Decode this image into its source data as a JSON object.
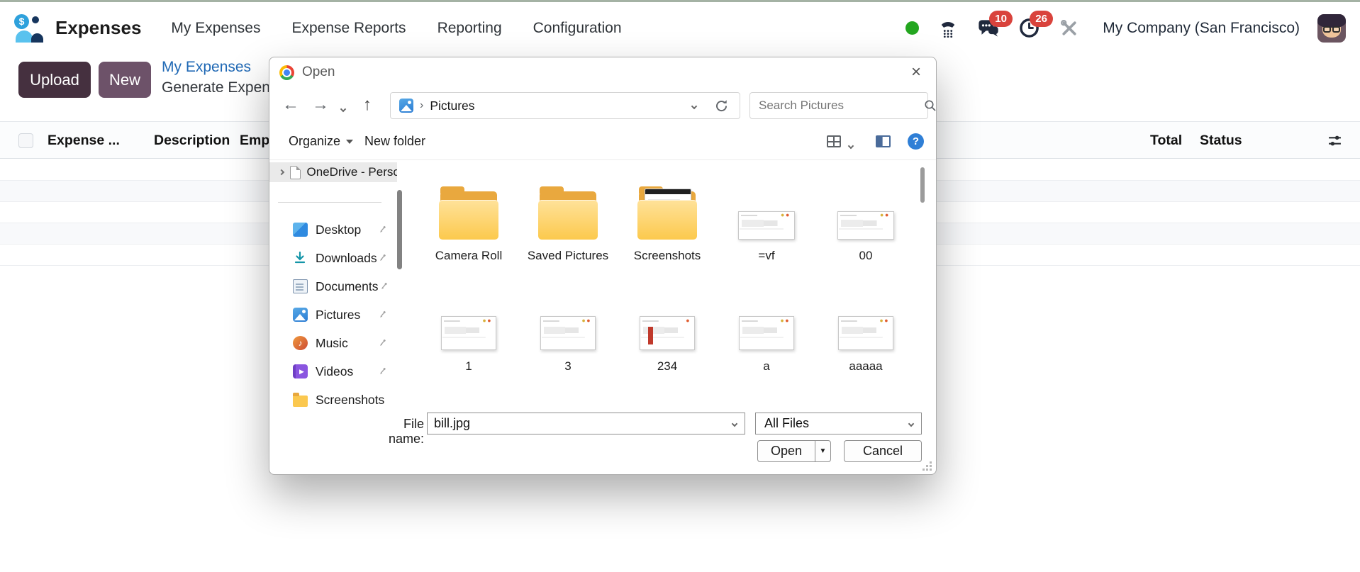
{
  "colors": {
    "top_accent": "#a4b2a4",
    "upload_button_bg": "#45303f",
    "new_button_bg": "#6d5269",
    "breadcrumb_link_blue": "#2069b5",
    "badge_red": "#d9433c",
    "status_green": "#23a61f",
    "folder_yellow": "#fcc94d",
    "help_blue": "#2f7fd6"
  },
  "icons": {
    "app": "expenses-app-icon",
    "status": "green-dot",
    "voip": "phone-icon",
    "messages": "chat-bubbles-icon",
    "activities": "clock-icon",
    "tools": "wrench-icon",
    "columns": "sliders-icon",
    "back": "left-arrow",
    "forward": "right-arrow",
    "parent": "up-arrow",
    "refresh": "circular-arrow",
    "search": "magnifier",
    "help": "question-circle",
    "browser": "chrome-logo",
    "pin": "pushpin",
    "dropdown": "chevron-down"
  },
  "navbar": {
    "app_name": "Expenses",
    "menus": [
      "My Expenses",
      "Expense Reports",
      "Reporting",
      "Configuration"
    ],
    "messages_badge": "10",
    "activities_badge": "26",
    "company": "My Company (San Francisco)"
  },
  "actionbar": {
    "upload_label": "Upload",
    "new_label": "New",
    "breadcrumb": "My Expenses",
    "subtitle": "Generate Expen"
  },
  "list": {
    "headers": [
      "Expense ...",
      "Description",
      "Emp"
    ],
    "total_header": "Total",
    "status_header": "Status"
  },
  "dialog": {
    "title": "Open",
    "nav": {
      "location": "Pictures",
      "search_placeholder": "Search Pictures"
    },
    "toolbar": {
      "organize_label": "Organize",
      "new_folder_label": "New folder"
    },
    "sidebar": {
      "onedrive_label": "OneDrive - Perso",
      "items": [
        "Desktop",
        "Downloads",
        "Documents",
        "Pictures",
        "Music",
        "Videos",
        "Screenshots"
      ]
    },
    "grid": {
      "row1": [
        {
          "label": "Camera Roll",
          "kind": "folder"
        },
        {
          "label": "Saved Pictures",
          "kind": "folder"
        },
        {
          "label": "Screenshots",
          "kind": "folder-with-screenshot"
        },
        {
          "label": "=vf",
          "kind": "image-file"
        },
        {
          "label": "00",
          "kind": "image-file"
        }
      ],
      "row2": [
        {
          "label": "1",
          "kind": "image-file"
        },
        {
          "label": "3",
          "kind": "image-file"
        },
        {
          "label": "234",
          "kind": "image-file"
        },
        {
          "label": "a",
          "kind": "image-file"
        },
        {
          "label": "aaaaa",
          "kind": "image-file"
        }
      ]
    },
    "footer": {
      "filename_label": "File name:",
      "filename_value": "bill.jpg",
      "filetype_value": "All Files",
      "open_label": "Open",
      "cancel_label": "Cancel"
    }
  }
}
